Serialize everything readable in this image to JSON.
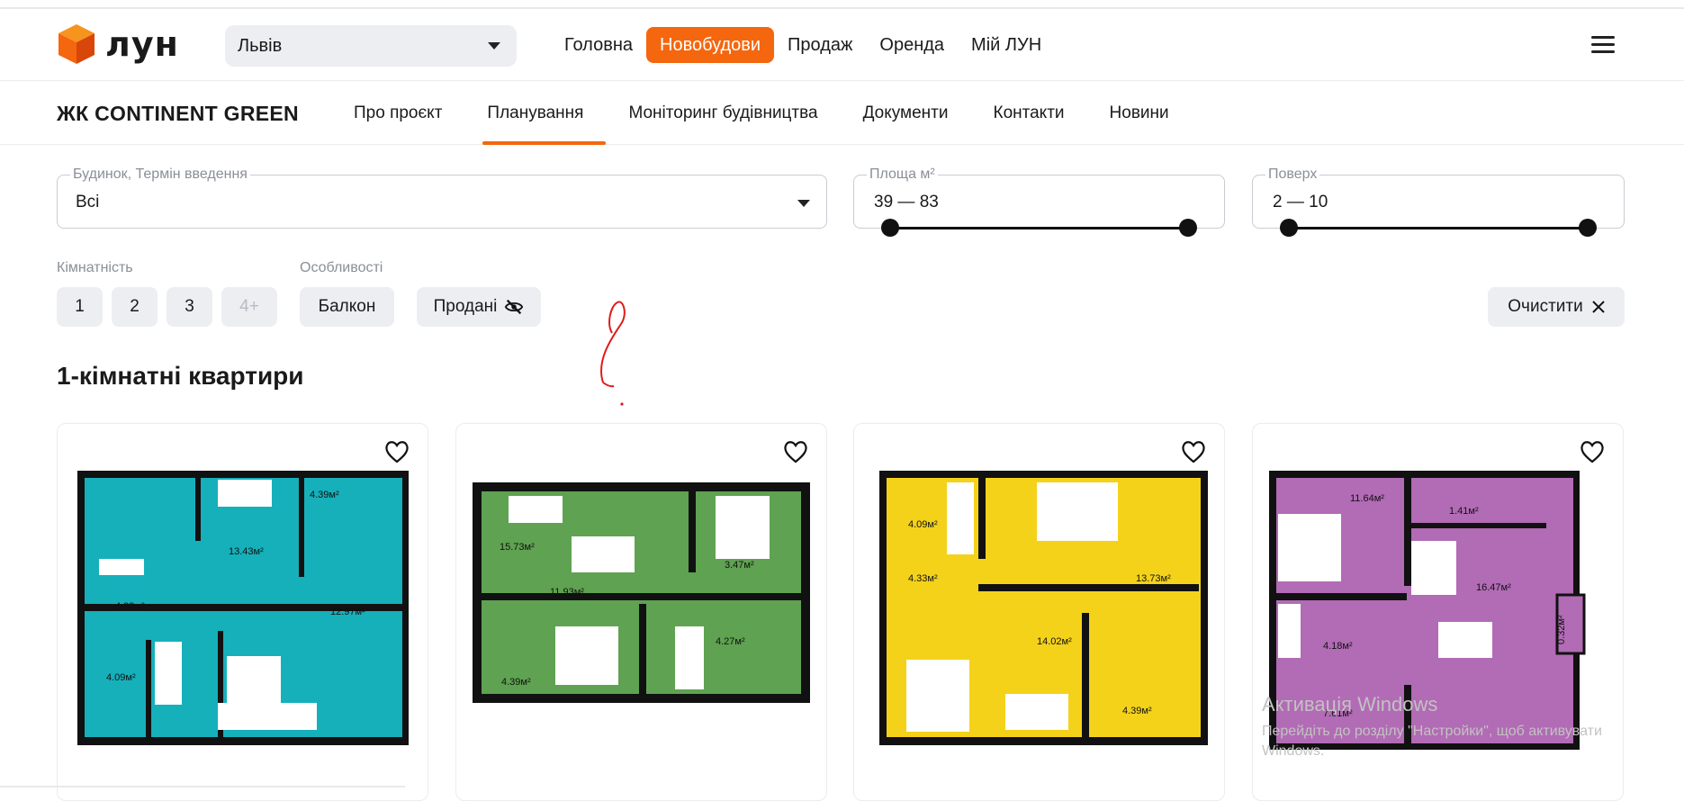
{
  "header": {
    "logo_text": "лун",
    "city": "Львів",
    "nav": [
      "Головна",
      "Новобудови",
      "Продаж",
      "Оренда",
      "Мій ЛУН"
    ],
    "active_nav": "Новобудови"
  },
  "project": {
    "title": "ЖК CONTINENT GREEN",
    "tabs": [
      "Про проєкт",
      "Планування",
      "Моніторинг будівництва",
      "Документи",
      "Контакти",
      "Новини"
    ],
    "active_tab": "Планування"
  },
  "filters": {
    "house": {
      "label": "Будинок, Термін введення",
      "value": "Всі"
    },
    "area": {
      "label": "Площа м²",
      "value": "39 — 83"
    },
    "floor": {
      "label": "Поверх",
      "value": "2 — 10"
    },
    "rooms_label": "Кімнатність",
    "rooms": [
      "1",
      "2",
      "3",
      "4+"
    ],
    "features_label": "Особливості",
    "features": [
      "Балкон",
      "Продані"
    ],
    "clear_label": "Очистити"
  },
  "section": {
    "title": "1-кімнатні квартири"
  },
  "cards": [
    {
      "color": "#16b0bb",
      "areas": [
        "4.39м²",
        "13.43м²",
        "4.33м²",
        "12.97м²",
        "4.09м²"
      ]
    },
    {
      "color": "#5fa251",
      "areas": [
        "15.73м²",
        "3.47м²",
        "11.93м²",
        "4.27м²",
        "4.39м²"
      ]
    },
    {
      "color": "#f4d21a",
      "areas": [
        "4.09м²",
        "4.33м²",
        "13.73м²",
        "14.02м²",
        "4.39м²"
      ]
    },
    {
      "color": "#b26bb5",
      "areas": [
        "11.64м²",
        "1.41м²",
        "16.47м²",
        "4.18м²",
        "0.32м²",
        "7.61м²"
      ]
    }
  ],
  "watermark": {
    "title": "Активація Windows",
    "text": "Перейдіть до розділу \"Настройки\", щоб активувати Windows."
  },
  "colors": {
    "accent": "#f4670f",
    "chip_bg": "#eceef2"
  }
}
